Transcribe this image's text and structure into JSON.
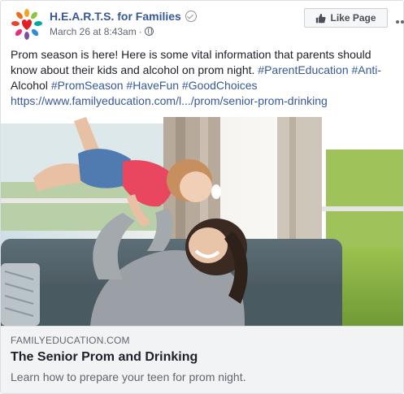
{
  "post": {
    "page_name": "H.E.A.R.T.S. for Families",
    "date": "March 26 at 8:43am",
    "dot": "·",
    "like_button": "Like Page",
    "text_intro": "Prom season is here! Here is some vital information that parents should know about their kids and alcohol on prom night. ",
    "hashtags_1": "#ParentEducation #Anti-",
    "text_mid": "Alcohol ",
    "hashtags_2": "#PromSeason #HaveFun #GoodChoices",
    "link_url": "https://www.familyeducation.com/l.../prom/senior-prom-drinking"
  },
  "link_preview": {
    "domain": "FAMILYEDUCATION.COM",
    "title": "The Senior Prom and Drinking",
    "description": "Learn how to prepare your teen for prom night."
  },
  "icons": {
    "avatar": "colorful-hands-heart-logo",
    "verified": "check-circle-icon",
    "privacy": "globe-icon",
    "like": "thumbs-up-icon",
    "more": "more-dots-icon"
  },
  "colors": {
    "link_blue": "#365899",
    "text": "#1d2129",
    "meta_gray": "#616770",
    "preview_bg": "#f2f3f5"
  }
}
